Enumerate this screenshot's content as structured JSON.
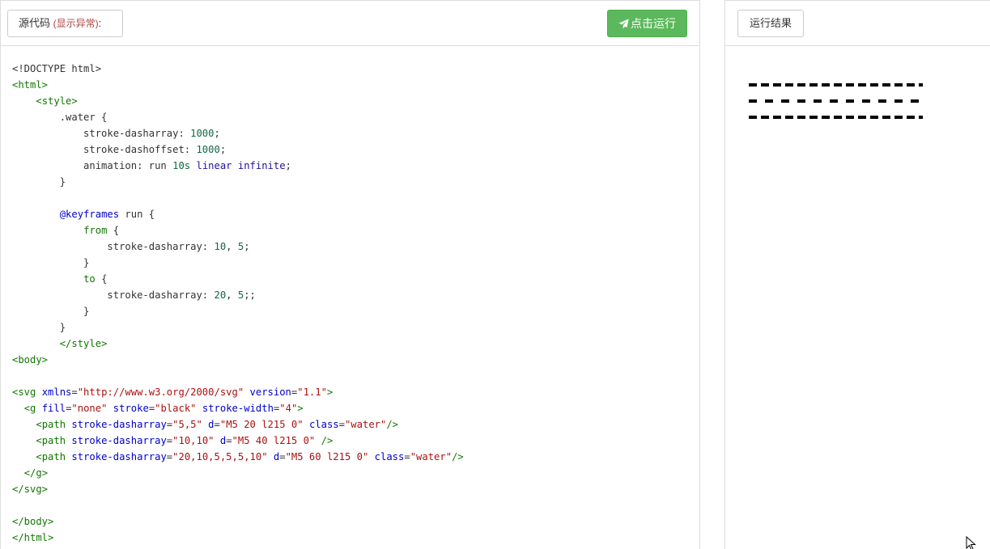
{
  "editor": {
    "source_label": "源代码",
    "source_warning": "(显示异常)",
    "source_suffix": ":",
    "run_label": "点击运行",
    "lines": [
      [
        {
          "t": "<!DOCTYPE html>",
          "c": "c-def"
        }
      ],
      [
        {
          "t": "<html>",
          "c": "c-tag"
        }
      ],
      [
        {
          "t": "    "
        },
        {
          "t": "<style>",
          "c": "c-tag"
        }
      ],
      [
        {
          "t": "        .water {",
          "c": "c-def"
        }
      ],
      [
        {
          "t": "            stroke-dasharray: "
        },
        {
          "t": "1000",
          "c": "c-num"
        },
        {
          "t": ";"
        }
      ],
      [
        {
          "t": "            stroke-dashoffset: "
        },
        {
          "t": "1000",
          "c": "c-num"
        },
        {
          "t": ";"
        }
      ],
      [
        {
          "t": "            animation: run "
        },
        {
          "t": "10s",
          "c": "c-num"
        },
        {
          "t": " "
        },
        {
          "t": "linear",
          "c": "c-atom"
        },
        {
          "t": " "
        },
        {
          "t": "infinite",
          "c": "c-atom"
        },
        {
          "t": ";"
        }
      ],
      [
        {
          "t": "        }"
        }
      ],
      [
        {
          "t": ""
        }
      ],
      [
        {
          "t": "        "
        },
        {
          "t": "@keyframes",
          "c": "c-attr"
        },
        {
          "t": " run {"
        }
      ],
      [
        {
          "t": "            "
        },
        {
          "t": "from",
          "c": "c-tag"
        },
        {
          "t": " {"
        }
      ],
      [
        {
          "t": "                stroke-dasharray: "
        },
        {
          "t": "10",
          "c": "c-num"
        },
        {
          "t": ", "
        },
        {
          "t": "5",
          "c": "c-num"
        },
        {
          "t": ";"
        }
      ],
      [
        {
          "t": "            }"
        }
      ],
      [
        {
          "t": "            "
        },
        {
          "t": "to",
          "c": "c-tag"
        },
        {
          "t": " {"
        }
      ],
      [
        {
          "t": "                stroke-dasharray: "
        },
        {
          "t": "20",
          "c": "c-num"
        },
        {
          "t": ", "
        },
        {
          "t": "5",
          "c": "c-num"
        },
        {
          "t": ";;"
        }
      ],
      [
        {
          "t": "            }"
        }
      ],
      [
        {
          "t": "        }"
        }
      ],
      [
        {
          "t": "        "
        },
        {
          "t": "</style>",
          "c": "c-tag"
        }
      ],
      [
        {
          "t": "<body>",
          "c": "c-tag"
        }
      ],
      [
        {
          "t": ""
        }
      ],
      [
        {
          "t": "<svg ",
          "c": "c-tag"
        },
        {
          "t": "xmlns",
          "c": "c-attr"
        },
        {
          "t": "="
        },
        {
          "t": "\"http://www.w3.org/2000/svg\"",
          "c": "c-str"
        },
        {
          "t": " "
        },
        {
          "t": "version",
          "c": "c-attr"
        },
        {
          "t": "="
        },
        {
          "t": "\"1.1\"",
          "c": "c-str"
        },
        {
          "t": ">",
          "c": "c-tag"
        }
      ],
      [
        {
          "t": "  "
        },
        {
          "t": "<g ",
          "c": "c-tag"
        },
        {
          "t": "fill",
          "c": "c-attr"
        },
        {
          "t": "="
        },
        {
          "t": "\"none\"",
          "c": "c-str"
        },
        {
          "t": " "
        },
        {
          "t": "stroke",
          "c": "c-attr"
        },
        {
          "t": "="
        },
        {
          "t": "\"black\"",
          "c": "c-str"
        },
        {
          "t": " "
        },
        {
          "t": "stroke-width",
          "c": "c-attr"
        },
        {
          "t": "="
        },
        {
          "t": "\"4\"",
          "c": "c-str"
        },
        {
          "t": ">",
          "c": "c-tag"
        }
      ],
      [
        {
          "t": "    "
        },
        {
          "t": "<path ",
          "c": "c-tag"
        },
        {
          "t": "stroke-dasharray",
          "c": "c-attr"
        },
        {
          "t": "="
        },
        {
          "t": "\"5,5\"",
          "c": "c-str"
        },
        {
          "t": " "
        },
        {
          "t": "d",
          "c": "c-attr"
        },
        {
          "t": "="
        },
        {
          "t": "\"M5 20 l215 0\"",
          "c": "c-str"
        },
        {
          "t": " "
        },
        {
          "t": "class",
          "c": "c-attr"
        },
        {
          "t": "="
        },
        {
          "t": "\"water\"",
          "c": "c-str"
        },
        {
          "t": "/>",
          "c": "c-tag"
        }
      ],
      [
        {
          "t": "    "
        },
        {
          "t": "<path ",
          "c": "c-tag"
        },
        {
          "t": "stroke-dasharray",
          "c": "c-attr"
        },
        {
          "t": "="
        },
        {
          "t": "\"10,10\"",
          "c": "c-str"
        },
        {
          "t": " "
        },
        {
          "t": "d",
          "c": "c-attr"
        },
        {
          "t": "="
        },
        {
          "t": "\"M5 40 l215 0\"",
          "c": "c-str"
        },
        {
          "t": " "
        },
        {
          "t": "/>",
          "c": "c-tag"
        }
      ],
      [
        {
          "t": "    "
        },
        {
          "t": "<path ",
          "c": "c-tag"
        },
        {
          "t": "stroke-dasharray",
          "c": "c-attr"
        },
        {
          "t": "="
        },
        {
          "t": "\"20,10,5,5,5,10\"",
          "c": "c-str"
        },
        {
          "t": " "
        },
        {
          "t": "d",
          "c": "c-attr"
        },
        {
          "t": "="
        },
        {
          "t": "\"M5 60 l215 0\"",
          "c": "c-str"
        },
        {
          "t": " "
        },
        {
          "t": "class",
          "c": "c-attr"
        },
        {
          "t": "="
        },
        {
          "t": "\"water\"",
          "c": "c-str"
        },
        {
          "t": "/>",
          "c": "c-tag"
        }
      ],
      [
        {
          "t": "  "
        },
        {
          "t": "</g>",
          "c": "c-tag"
        }
      ],
      [
        {
          "t": "</svg>",
          "c": "c-tag"
        }
      ],
      [
        {
          "t": ""
        }
      ],
      [
        {
          "t": "</body>",
          "c": "c-tag"
        }
      ],
      [
        {
          "t": "</html>",
          "c": "c-tag"
        }
      ]
    ]
  },
  "result": {
    "label": "运行结果"
  },
  "colors": {
    "run_button": "#5cb85c",
    "warning_text": "#a94442"
  }
}
